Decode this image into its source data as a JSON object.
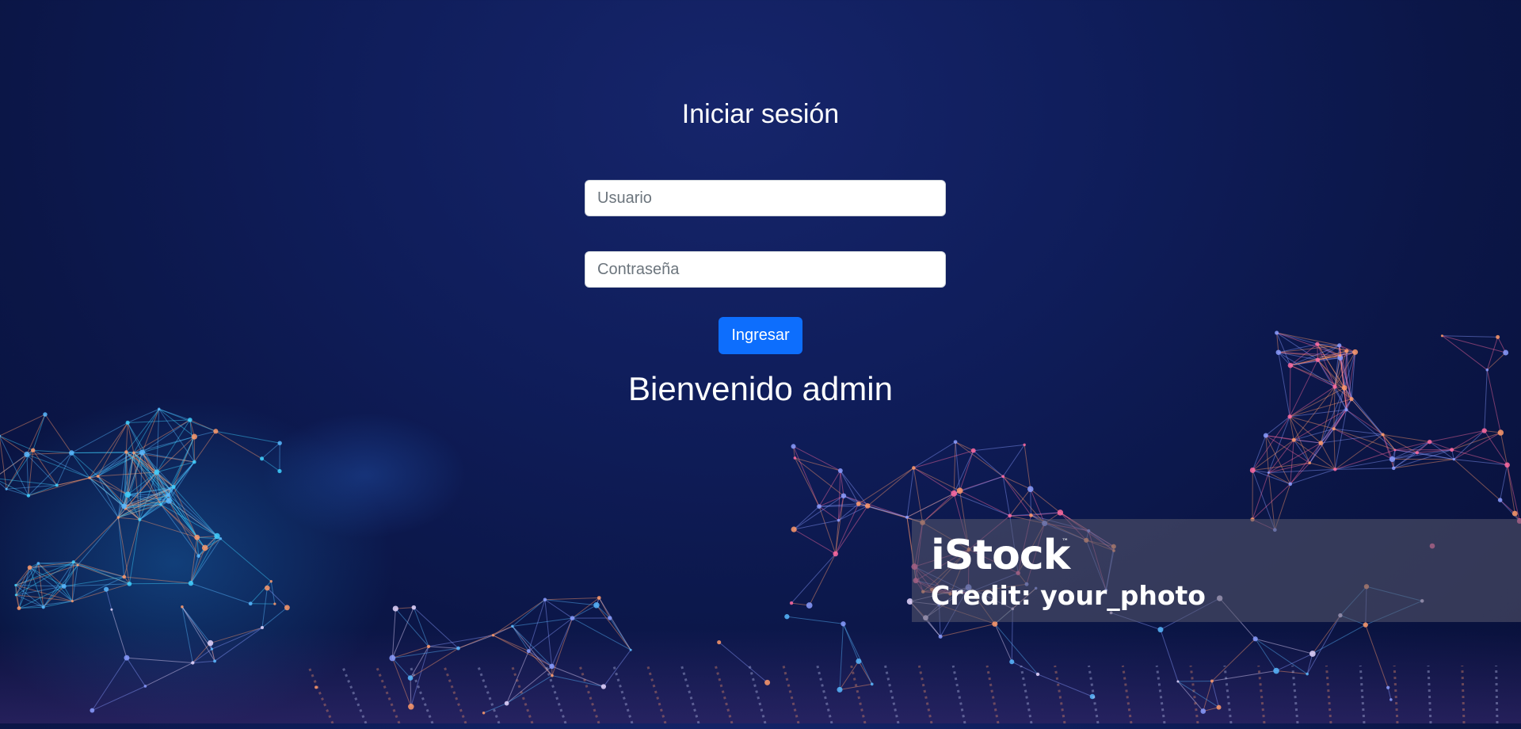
{
  "login": {
    "title": "Iniciar sesión",
    "username_placeholder": "Usuario",
    "username_value": "",
    "password_placeholder": "Contraseña",
    "password_value": "",
    "submit_label": "Ingresar",
    "welcome_message": "Bienvenido admin"
  },
  "watermark": {
    "brand": "iStock",
    "trademark": "™",
    "credit": "Credit: your_photo"
  },
  "colors": {
    "background": "#0f1d5a",
    "button": "#0d6efd",
    "text": "#ffffff"
  }
}
